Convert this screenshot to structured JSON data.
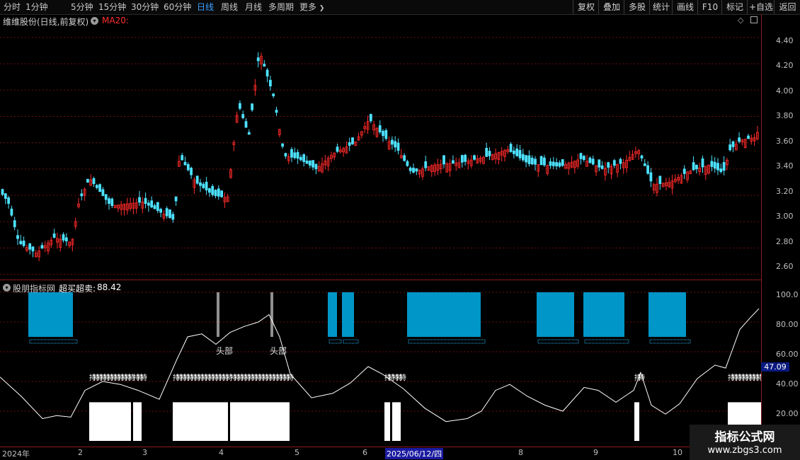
{
  "toolbar": {
    "periods": [
      "分时",
      "1分钟",
      "5分钟",
      "15分钟",
      "30分钟",
      "60分钟",
      "日线",
      "周线",
      "月线",
      "多周期",
      "更多"
    ],
    "active_period": "日线",
    "more_arrow": "❯",
    "right_buttons": [
      "复权",
      "叠加",
      "多股",
      "统计",
      "画线",
      "F10",
      "标记",
      "+自选",
      "返回"
    ]
  },
  "main_chart": {
    "title": "维维股份(日线,前复权)",
    "ma_label": "MA20:",
    "ma_color": "#ff3030",
    "y_ticks": [
      "4.40",
      "4.20",
      "4.00",
      "3.80",
      "3.60",
      "3.40",
      "3.20",
      "3.00",
      "2.80",
      "2.60"
    ],
    "up_color": "#ff2a2a",
    "down_color": "#4de1ff"
  },
  "indicator": {
    "name": "股朋指标网",
    "label": "超买超卖:",
    "value": "88.42",
    "y_ticks": [
      "100.0",
      "80.00",
      "60.00",
      "40.00",
      "20.00"
    ],
    "current_value_tag": "47.09",
    "head_labels": [
      "头部",
      "头部"
    ],
    "hold_label": "持"
  },
  "date_axis": {
    "labels": [
      "2024年",
      "2",
      "3",
      "4",
      "5",
      "6",
      "2025/06/12/四",
      "8",
      "9",
      "10"
    ]
  },
  "logo": {
    "line1": "指标公式网",
    "line2": "www.zbgs3.com"
  },
  "chart_data": [
    {
      "type": "candlestick",
      "title": "维维股份(日线,前复权)",
      "y_ticks": [
        "2.60",
        "2.80",
        "3.00",
        "3.20",
        "3.40",
        "3.60",
        "3.80",
        "4.00",
        "4.20",
        "4.40"
      ],
      "ylim": [
        2.56,
        4.48
      ],
      "approx_close_path": [
        {
          "x": 0,
          "y": 3.22
        },
        {
          "x": 10,
          "y": 3.15
        },
        {
          "x": 25,
          "y": 2.84
        },
        {
          "x": 50,
          "y": 2.76
        },
        {
          "x": 75,
          "y": 2.88
        },
        {
          "x": 100,
          "y": 2.84
        },
        {
          "x": 110,
          "y": 3.15
        },
        {
          "x": 125,
          "y": 3.33
        },
        {
          "x": 155,
          "y": 3.12
        },
        {
          "x": 200,
          "y": 3.15
        },
        {
          "x": 245,
          "y": 3.01
        },
        {
          "x": 252,
          "y": 3.5
        },
        {
          "x": 275,
          "y": 3.3
        },
        {
          "x": 300,
          "y": 3.2
        },
        {
          "x": 320,
          "y": 3.18
        },
        {
          "x": 335,
          "y": 3.9
        },
        {
          "x": 350,
          "y": 3.65
        },
        {
          "x": 365,
          "y": 4.3
        },
        {
          "x": 385,
          "y": 3.95
        },
        {
          "x": 400,
          "y": 3.5
        },
        {
          "x": 420,
          "y": 3.48
        },
        {
          "x": 445,
          "y": 3.4
        },
        {
          "x": 470,
          "y": 3.52
        },
        {
          "x": 500,
          "y": 3.6
        },
        {
          "x": 520,
          "y": 3.78
        },
        {
          "x": 540,
          "y": 3.65
        },
        {
          "x": 560,
          "y": 3.55
        },
        {
          "x": 580,
          "y": 3.37
        },
        {
          "x": 610,
          "y": 3.43
        },
        {
          "x": 650,
          "y": 3.45
        },
        {
          "x": 690,
          "y": 3.5
        },
        {
          "x": 715,
          "y": 3.55
        },
        {
          "x": 745,
          "y": 3.44
        },
        {
          "x": 790,
          "y": 3.42
        },
        {
          "x": 820,
          "y": 3.48
        },
        {
          "x": 850,
          "y": 3.4
        },
        {
          "x": 880,
          "y": 3.45
        },
        {
          "x": 900,
          "y": 3.55
        },
        {
          "x": 920,
          "y": 3.28
        },
        {
          "x": 945,
          "y": 3.3
        },
        {
          "x": 970,
          "y": 3.38
        },
        {
          "x": 1000,
          "y": 3.43
        },
        {
          "x": 1020,
          "y": 3.37
        },
        {
          "x": 1030,
          "y": 3.55
        },
        {
          "x": 1045,
          "y": 3.62
        },
        {
          "x": 1065,
          "y": 3.64
        },
        {
          "x": 1072,
          "y": 3.72
        }
      ]
    },
    {
      "type": "line",
      "title": "超买超卖",
      "y_ticks": [
        "20.00",
        "40.00",
        "60.00",
        "80.00",
        "100.0"
      ],
      "ylim": [
        0,
        105
      ],
      "series": [
        {
          "name": "超买超卖",
          "values": [
            {
              "x": 0,
              "y": 43
            },
            {
              "x": 30,
              "y": 30
            },
            {
              "x": 60,
              "y": 15
            },
            {
              "x": 80,
              "y": 17
            },
            {
              "x": 100,
              "y": 16
            },
            {
              "x": 120,
              "y": 34
            },
            {
              "x": 145,
              "y": 40
            },
            {
              "x": 170,
              "y": 38
            },
            {
              "x": 195,
              "y": 34
            },
            {
              "x": 225,
              "y": 28
            },
            {
              "x": 250,
              "y": 55
            },
            {
              "x": 265,
              "y": 70
            },
            {
              "x": 285,
              "y": 72
            },
            {
              "x": 305,
              "y": 65
            },
            {
              "x": 325,
              "y": 73
            },
            {
              "x": 345,
              "y": 77
            },
            {
              "x": 365,
              "y": 80
            },
            {
              "x": 380,
              "y": 85
            },
            {
              "x": 395,
              "y": 70
            },
            {
              "x": 410,
              "y": 45
            },
            {
              "x": 440,
              "y": 29
            },
            {
              "x": 470,
              "y": 32
            },
            {
              "x": 495,
              "y": 39
            },
            {
              "x": 520,
              "y": 50
            },
            {
              "x": 540,
              "y": 45
            },
            {
              "x": 570,
              "y": 35
            },
            {
              "x": 600,
              "y": 22
            },
            {
              "x": 630,
              "y": 13
            },
            {
              "x": 660,
              "y": 15
            },
            {
              "x": 680,
              "y": 20
            },
            {
              "x": 700,
              "y": 34
            },
            {
              "x": 720,
              "y": 38
            },
            {
              "x": 745,
              "y": 30
            },
            {
              "x": 770,
              "y": 24
            },
            {
              "x": 795,
              "y": 20
            },
            {
              "x": 825,
              "y": 36
            },
            {
              "x": 845,
              "y": 34
            },
            {
              "x": 870,
              "y": 26
            },
            {
              "x": 895,
              "y": 34
            },
            {
              "x": 905,
              "y": 46
            },
            {
              "x": 920,
              "y": 24
            },
            {
              "x": 940,
              "y": 18
            },
            {
              "x": 960,
              "y": 25
            },
            {
              "x": 985,
              "y": 42
            },
            {
              "x": 1010,
              "y": 51
            },
            {
              "x": 1025,
              "y": 49
            },
            {
              "x": 1045,
              "y": 75
            },
            {
              "x": 1060,
              "y": 83
            },
            {
              "x": 1072,
              "y": 89
            }
          ]
        }
      ],
      "overbought_zones_x": [
        [
          40,
          103
        ],
        [
          463,
          476
        ],
        [
          483,
          500
        ],
        [
          575,
          679
        ],
        [
          758,
          811
        ],
        [
          824,
          882
        ],
        [
          916,
          969
        ]
      ],
      "oversold_zones_x": [
        [
          126,
          185
        ],
        [
          188,
          200
        ],
        [
          244,
          322
        ],
        [
          325,
          409
        ],
        [
          543,
          551
        ],
        [
          554,
          566
        ],
        [
          896,
          903
        ],
        [
          1028,
          1075
        ]
      ],
      "head_marks_x": [
        308,
        384
      ]
    }
  ]
}
